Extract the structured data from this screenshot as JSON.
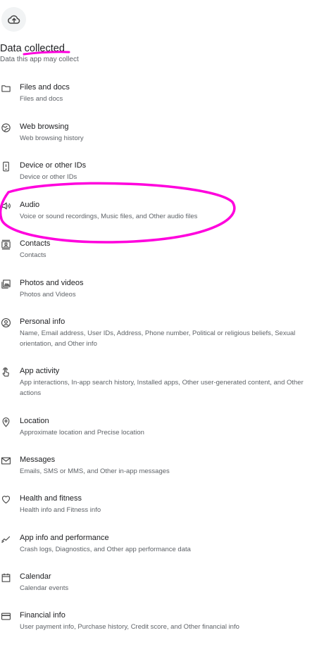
{
  "header": {
    "title": "Data collected",
    "subtitle": "Data this app may collect"
  },
  "items": [
    {
      "label": "Files and docs",
      "desc": "Files and docs",
      "icon": "folder-icon"
    },
    {
      "label": "Web browsing",
      "desc": "Web browsing history",
      "icon": "globe-icon"
    },
    {
      "label": "Device or other IDs",
      "desc": "Device or other IDs",
      "icon": "device-icon"
    },
    {
      "label": "Audio",
      "desc": "Voice or sound recordings, Music files, and Other audio files",
      "icon": "speaker-icon"
    },
    {
      "label": "Contacts",
      "desc": "Contacts",
      "icon": "contacts-icon"
    },
    {
      "label": "Photos and videos",
      "desc": "Photos and Videos",
      "icon": "image-icon"
    },
    {
      "label": "Personal info",
      "desc": "Name, Email address, User IDs, Address, Phone number, Political or religious beliefs, Sexual orientation, and Other info",
      "icon": "person-icon"
    },
    {
      "label": "App activity",
      "desc": "App interactions, In-app search history, Installed apps, Other user-generated content, and Other actions",
      "icon": "touch-icon"
    },
    {
      "label": "Location",
      "desc": "Approximate location and Precise location",
      "icon": "location-pin-icon"
    },
    {
      "label": "Messages",
      "desc": "Emails, SMS or MMS, and Other in-app messages",
      "icon": "mail-icon"
    },
    {
      "label": "Health and fitness",
      "desc": "Health info and Fitness info",
      "icon": "heart-icon"
    },
    {
      "label": "App info and performance",
      "desc": "Crash logs, Diagnostics, and Other app performance data",
      "icon": "performance-icon"
    },
    {
      "label": "Calendar",
      "desc": "Calendar events",
      "icon": "calendar-icon"
    },
    {
      "label": "Financial info",
      "desc": "User payment info, Purchase history, Credit score, and Other financial info",
      "icon": "credit-card-icon"
    }
  ],
  "colors": {
    "annotation": "#ff00dd",
    "text_primary": "#202124",
    "text_secondary": "#5f6368"
  }
}
